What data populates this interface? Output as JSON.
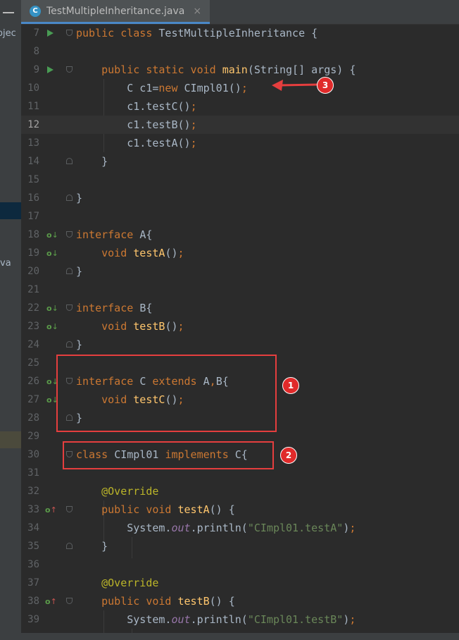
{
  "sidebar": {
    "fragments": [
      {
        "id": "project",
        "text": "ojec"
      },
      {
        "id": "java",
        "text": "va"
      }
    ]
  },
  "tab": {
    "filename": "TestMultipleInheritance.java",
    "file_icon": "C",
    "close": "×"
  },
  "lines": [
    {
      "n": "7",
      "gutter": "run",
      "fold": "open",
      "tokens": [
        [
          "kw",
          "public class "
        ],
        [
          "",
          "TestMultipleInheritance {"
        ]
      ]
    },
    {
      "n": "8",
      "gutter": "",
      "fold": "",
      "tokens": []
    },
    {
      "n": "9",
      "gutter": "run",
      "fold": "open",
      "tokens": [
        [
          "",
          "    "
        ],
        [
          "kw",
          "public static void "
        ],
        [
          "fn",
          "main"
        ],
        [
          "",
          "(String[] args) {"
        ]
      ]
    },
    {
      "n": "10",
      "gutter": "",
      "fold": "",
      "tokens": [
        [
          "",
          "        C c1="
        ],
        [
          "kw",
          "new "
        ],
        [
          "",
          "CImpl01()"
        ],
        [
          "kw",
          ";"
        ]
      ]
    },
    {
      "n": "11",
      "gutter": "",
      "fold": "",
      "tokens": [
        [
          "",
          "        c1.testC()"
        ],
        [
          "kw",
          ";"
        ]
      ]
    },
    {
      "n": "12",
      "gutter": "",
      "fold": "",
      "current": true,
      "tokens": [
        [
          "",
          "        c1.testB()"
        ],
        [
          "kw",
          ";"
        ]
      ]
    },
    {
      "n": "13",
      "gutter": "",
      "fold": "",
      "tokens": [
        [
          "",
          "        c1.testA()"
        ],
        [
          "kw",
          ";"
        ]
      ]
    },
    {
      "n": "14",
      "gutter": "",
      "fold": "close",
      "tokens": [
        [
          "",
          "    }"
        ]
      ]
    },
    {
      "n": "15",
      "gutter": "",
      "fold": "",
      "tokens": []
    },
    {
      "n": "16",
      "gutter": "",
      "fold": "close",
      "tokens": [
        [
          "",
          "}"
        ]
      ]
    },
    {
      "n": "17",
      "gutter": "",
      "fold": "",
      "tokens": []
    },
    {
      "n": "18",
      "gutter": "impl",
      "fold": "open",
      "tokens": [
        [
          "kw",
          "interface "
        ],
        [
          "",
          "A{"
        ]
      ]
    },
    {
      "n": "19",
      "gutter": "impl",
      "fold": "",
      "tokens": [
        [
          "",
          "    "
        ],
        [
          "kw",
          "void "
        ],
        [
          "fn",
          "testA"
        ],
        [
          "",
          "()"
        ],
        [
          "kw",
          ";"
        ]
      ]
    },
    {
      "n": "20",
      "gutter": "",
      "fold": "close",
      "tokens": [
        [
          "",
          "}"
        ]
      ]
    },
    {
      "n": "21",
      "gutter": "",
      "fold": "",
      "tokens": []
    },
    {
      "n": "22",
      "gutter": "impl",
      "fold": "open",
      "tokens": [
        [
          "kw",
          "interface "
        ],
        [
          "",
          "B{"
        ]
      ]
    },
    {
      "n": "23",
      "gutter": "impl",
      "fold": "",
      "tokens": [
        [
          "",
          "    "
        ],
        [
          "kw",
          "void "
        ],
        [
          "fn",
          "testB"
        ],
        [
          "",
          "()"
        ],
        [
          "kw",
          ";"
        ]
      ]
    },
    {
      "n": "24",
      "gutter": "",
      "fold": "close",
      "tokens": [
        [
          "",
          "}"
        ]
      ]
    },
    {
      "n": "25",
      "gutter": "",
      "fold": "",
      "tokens": []
    },
    {
      "n": "26",
      "gutter": "impl",
      "fold": "open",
      "tokens": [
        [
          "kw",
          "interface "
        ],
        [
          "",
          "C "
        ],
        [
          "kw",
          "extends "
        ],
        [
          "",
          "A"
        ],
        [
          "kw",
          ","
        ],
        [
          "",
          "B{"
        ]
      ]
    },
    {
      "n": "27",
      "gutter": "impl",
      "fold": "",
      "tokens": [
        [
          "",
          "    "
        ],
        [
          "kw",
          "void "
        ],
        [
          "fn",
          "testC"
        ],
        [
          "",
          "()"
        ],
        [
          "kw",
          ";"
        ]
      ]
    },
    {
      "n": "28",
      "gutter": "",
      "fold": "close",
      "tokens": [
        [
          "",
          "}"
        ]
      ]
    },
    {
      "n": "29",
      "gutter": "",
      "fold": "",
      "tokens": []
    },
    {
      "n": "30",
      "gutter": "",
      "fold": "open",
      "tokens": [
        [
          "kw",
          "class "
        ],
        [
          "",
          "CImpl01 "
        ],
        [
          "kw",
          "implements "
        ],
        [
          "",
          "C{"
        ]
      ]
    },
    {
      "n": "31",
      "gutter": "",
      "fold": "",
      "tokens": []
    },
    {
      "n": "32",
      "gutter": "",
      "fold": "",
      "tokens": [
        [
          "",
          "    "
        ],
        [
          "an",
          "@Override"
        ]
      ]
    },
    {
      "n": "33",
      "gutter": "override",
      "fold": "open",
      "tokens": [
        [
          "",
          "    "
        ],
        [
          "kw",
          "public void "
        ],
        [
          "fn",
          "testA"
        ],
        [
          "",
          "() {"
        ]
      ]
    },
    {
      "n": "34",
      "gutter": "",
      "fold": "",
      "tokens": [
        [
          "",
          "        System."
        ],
        [
          "it",
          "out"
        ],
        [
          "",
          ".println("
        ],
        [
          "st",
          "\"CImpl01.testA\""
        ],
        [
          "",
          ")"
        ],
        [
          "kw",
          ";"
        ]
      ]
    },
    {
      "n": "35",
      "gutter": "",
      "fold": "close",
      "tokens": [
        [
          "",
          "    }"
        ]
      ]
    },
    {
      "n": "36",
      "gutter": "",
      "fold": "",
      "tokens": []
    },
    {
      "n": "37",
      "gutter": "",
      "fold": "",
      "tokens": [
        [
          "",
          "    "
        ],
        [
          "an",
          "@Override"
        ]
      ]
    },
    {
      "n": "38",
      "gutter": "override",
      "fold": "open",
      "tokens": [
        [
          "",
          "    "
        ],
        [
          "kw",
          "public void "
        ],
        [
          "fn",
          "testB"
        ],
        [
          "",
          "() {"
        ]
      ]
    },
    {
      "n": "39",
      "gutter": "",
      "fold": "",
      "tokens": [
        [
          "",
          "        System."
        ],
        [
          "it",
          "out"
        ],
        [
          "",
          ".println("
        ],
        [
          "st",
          "\"CImpl01.testB\""
        ],
        [
          "",
          ")"
        ],
        [
          "kw",
          ";"
        ]
      ]
    }
  ],
  "annotations": [
    {
      "label": "1",
      "target": "interface-c-block"
    },
    {
      "label": "2",
      "target": "class-cimpl01-line"
    },
    {
      "label": "3",
      "target": "new-cimpl01-line"
    }
  ],
  "colors": {
    "editor_bg": "#2b2b2b",
    "keyword": "#cc7832",
    "method": "#ffc66d",
    "annotation": "#bbb529",
    "string": "#6a8759",
    "annotation_marker": "#e53e3e"
  }
}
